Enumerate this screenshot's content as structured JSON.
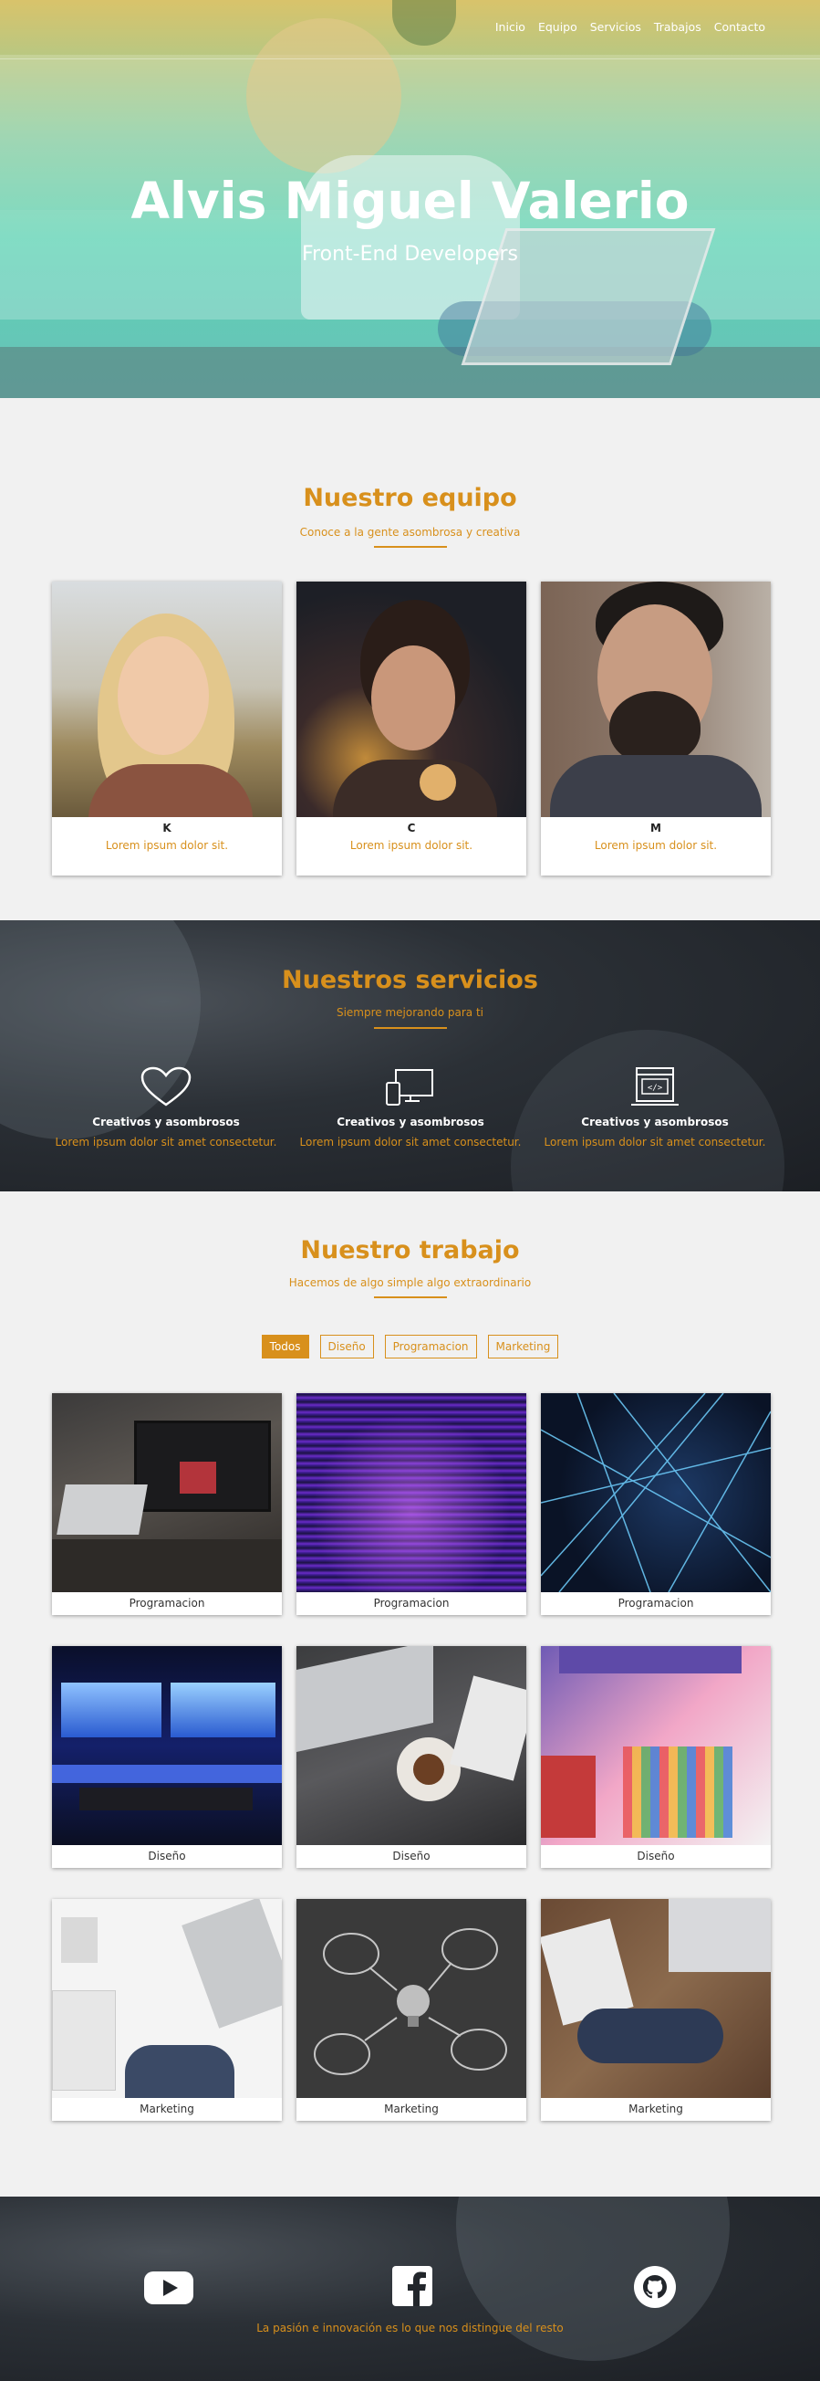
{
  "nav": {
    "items": [
      "Inicio",
      "Equipo",
      "Servicios",
      "Trabajos",
      "Contacto"
    ]
  },
  "hero": {
    "title": "Alvis Miguel Valerio",
    "subtitle": "Front-End Developers"
  },
  "team": {
    "title": "Nuestro equipo",
    "subtitle": "Conoce a la gente asombrosa y creativa",
    "members": [
      {
        "name": "K",
        "desc": "Lorem ipsum dolor sit."
      },
      {
        "name": "C",
        "desc": "Lorem ipsum dolor sit."
      },
      {
        "name": "M",
        "desc": "Lorem ipsum dolor sit."
      }
    ]
  },
  "services": {
    "title": "Nuestros servicios",
    "subtitle": "Siempre mejorando para ti",
    "items": [
      {
        "icon": "heart-icon",
        "title": "Creativos y asombrosos",
        "desc": "Lorem ipsum dolor sit amet consectetur."
      },
      {
        "icon": "devices-icon",
        "title": "Creativos y asombrosos",
        "desc": "Lorem ipsum dolor sit amet consectetur."
      },
      {
        "icon": "code-window-icon",
        "title": "Creativos y asombrosos",
        "desc": "Lorem ipsum dolor sit amet consectetur."
      }
    ]
  },
  "work": {
    "title": "Nuestro trabajo",
    "subtitle": "Hacemos de algo simple algo extraordinario",
    "filters": [
      "Todos",
      "Diseño",
      "Programacion",
      "Marketing"
    ],
    "active_filter": "Todos",
    "items": [
      {
        "label": "Programacion"
      },
      {
        "label": "Programacion"
      },
      {
        "label": "Programacion"
      },
      {
        "label": "Diseño"
      },
      {
        "label": "Diseño"
      },
      {
        "label": "Diseño"
      },
      {
        "label": "Marketing"
      },
      {
        "label": "Marketing"
      },
      {
        "label": "Marketing"
      }
    ]
  },
  "footer": {
    "icons": [
      "youtube-icon",
      "facebook-icon",
      "github-icon"
    ],
    "tagline": "La pasión e innovación es lo que nos distingue del resto"
  },
  "colors": {
    "accent": "#d8901c",
    "background": "#f1f1f1",
    "dark": "#22262b"
  }
}
